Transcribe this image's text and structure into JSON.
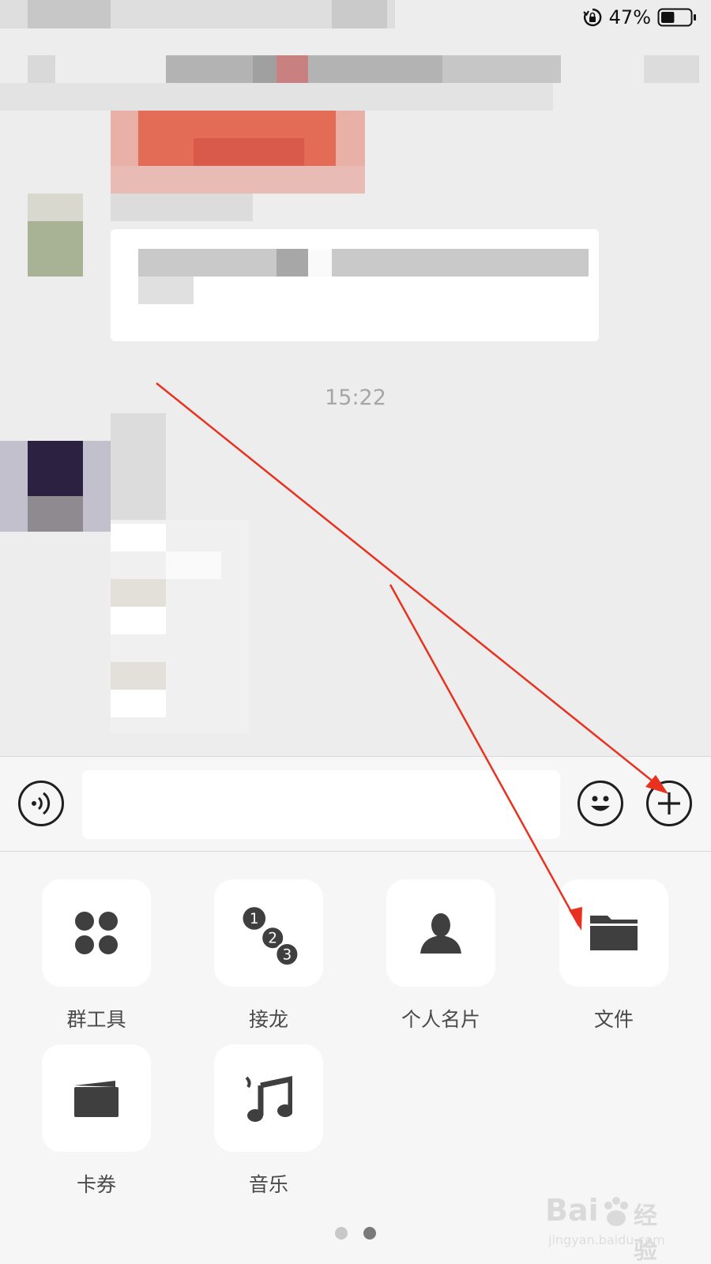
{
  "status_bar": {
    "battery_percent": "47%",
    "battery_level": 0.47,
    "icons": [
      "rotation-lock-icon",
      "battery-icon"
    ]
  },
  "chat": {
    "time_label": "15:22"
  },
  "input_bar": {
    "input_value": "",
    "icons": [
      "voice-icon",
      "emoji-icon",
      "plus-icon"
    ]
  },
  "panel": {
    "tools": [
      {
        "label": "群工具",
        "icon": "group-tools-icon"
      },
      {
        "label": "接龙",
        "icon": "solitaire-icon"
      },
      {
        "label": "个人名片",
        "icon": "contact-card-icon"
      },
      {
        "label": "文件",
        "icon": "folder-icon"
      },
      {
        "label": "卡券",
        "icon": "wallet-icon"
      },
      {
        "label": "音乐",
        "icon": "music-icon"
      }
    ],
    "page_count": 2,
    "current_page": 2
  },
  "watermark": {
    "brand": "Bai",
    "brand_cn": "经验",
    "url": "jingyan.baidu.com"
  },
  "colors": {
    "annotation_arrow": "#e8321f",
    "chat_background": "#ededed",
    "panel_background": "#f6f6f6",
    "icon_dark": "#3f3f3f"
  }
}
